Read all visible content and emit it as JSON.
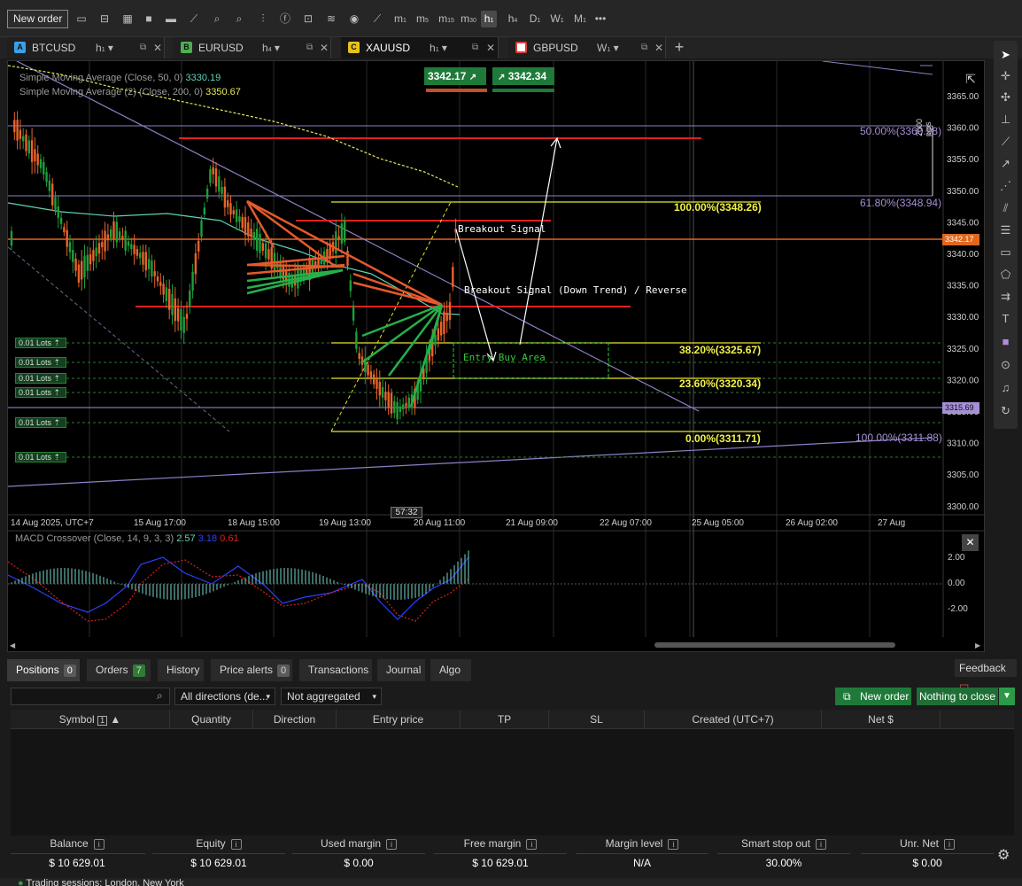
{
  "toolbar": {
    "new_order": "New order",
    "timeframes": [
      "m",
      "m",
      "m",
      "m",
      "h",
      "h",
      "D",
      "W",
      "M"
    ],
    "timeframe_subs": [
      "1",
      "5",
      "15",
      "30",
      "1",
      "4",
      "1",
      "1",
      "1"
    ],
    "active_timeframe": "h1",
    "more": "•••"
  },
  "tabs": [
    {
      "symbol": "BTCUSD",
      "badge": "A",
      "badge_color": "#3aa0e8",
      "tf": "h",
      "tf_sub": "1"
    },
    {
      "symbol": "EURUSD",
      "badge": "B",
      "badge_color": "#4caf50",
      "tf": "h",
      "tf_sub": "4"
    },
    {
      "symbol": "XAUUSD",
      "badge": "C",
      "badge_color": "#e8c21a",
      "tf": "h",
      "tf_sub": "1",
      "active": true
    },
    {
      "symbol": "GBPUSD",
      "badge": "",
      "badge_color": "#e03a3a",
      "tf": "W",
      "tf_sub": "1"
    }
  ],
  "chart": {
    "indicators": [
      {
        "name": "Simple Moving Average (Close, 50, 0)",
        "value": "3330.19",
        "color": "#5fd3b8"
      },
      {
        "name": "Simple Moving Average (2) (Close, 200, 0)",
        "value": "3350.67",
        "color": "#e8e85a"
      }
    ],
    "sell_price": "3342.17",
    "buy_price": "3342.34",
    "price_axis": [
      "3365.00",
      "3360.00",
      "3355.00",
      "3350.00",
      "3345.00",
      "3340.00",
      "3335.00",
      "3330.00",
      "3325.00",
      "3320.00",
      "3315.00",
      "3310.00",
      "3305.00",
      "3300.00"
    ],
    "current_price": "3342.17",
    "marker_price": "3315.69",
    "time_axis": [
      "14 Aug 2025, UTC+7",
      "15 Aug 17:00",
      "18 Aug 15:00",
      "19 Aug 13:00",
      "20 Aug 11:00",
      "21 Aug 09:00",
      "22 Aug 07:00",
      "25 Aug 05:00",
      "26 Aug 02:00",
      "27 Aug"
    ],
    "countdown": "57:32",
    "fib_labels": [
      "100.00%(3348.26)",
      "38.20%(3325.67)",
      "23.60%(3320.34)",
      "0.00%(3311.71)"
    ],
    "fib2_labels": [
      "50.00%(3360.98)",
      "61.80%(3348.94)",
      "100.00%(3311.88)"
    ],
    "pips_label": "2000 pips",
    "annotations": [
      "Breakout Signal",
      "Breakout Signal (Down Trend) / Reverse",
      "Entry Buy Area"
    ],
    "lots": [
      "0.01 Lots",
      "0.01 Lots",
      "0.01 Lots",
      "0.01 Lots",
      "0.01 Lots",
      "0.01 Lots"
    ],
    "macd": {
      "title": "MACD Crossover (Close, 14, 9, 3, 3)",
      "v1": "2.57",
      "v2": "3.18",
      "v3": "0.61",
      "axis": [
        "2.00",
        "0.00",
        "-2.00"
      ]
    }
  },
  "bottom": {
    "tabs": [
      {
        "label": "Positions",
        "count": "0"
      },
      {
        "label": "Orders",
        "count": "7"
      },
      {
        "label": "History",
        "count": ""
      },
      {
        "label": "Price alerts",
        "count": "0"
      },
      {
        "label": "Transactions",
        "count": ""
      },
      {
        "label": "Journal",
        "count": ""
      },
      {
        "label": "Algo",
        "count": ""
      }
    ],
    "feedback": "Feedback",
    "direction_filter": "All directions (de...",
    "aggregation": "Not aggregated",
    "new_order": "New order",
    "nothing_to_close": "Nothing to close",
    "columns": [
      "Symbol",
      "Quantity",
      "Direction",
      "Entry price",
      "TP",
      "SL",
      "Created (UTC+7)",
      "Net $"
    ],
    "sort_index": "1",
    "summary": [
      {
        "label": "Balance",
        "value": "$ 10 629.01"
      },
      {
        "label": "Equity",
        "value": "$ 10 629.01"
      },
      {
        "label": "Used margin",
        "value": "$ 0.00"
      },
      {
        "label": "Free margin",
        "value": "$ 10 629.01"
      },
      {
        "label": "Margin level",
        "value": "N/A"
      },
      {
        "label": "Smart stop out",
        "value": "30.00%"
      },
      {
        "label": "Unr. Net",
        "value": "$ 0.00"
      }
    ],
    "sessions": "Trading sessions: London, New York"
  }
}
